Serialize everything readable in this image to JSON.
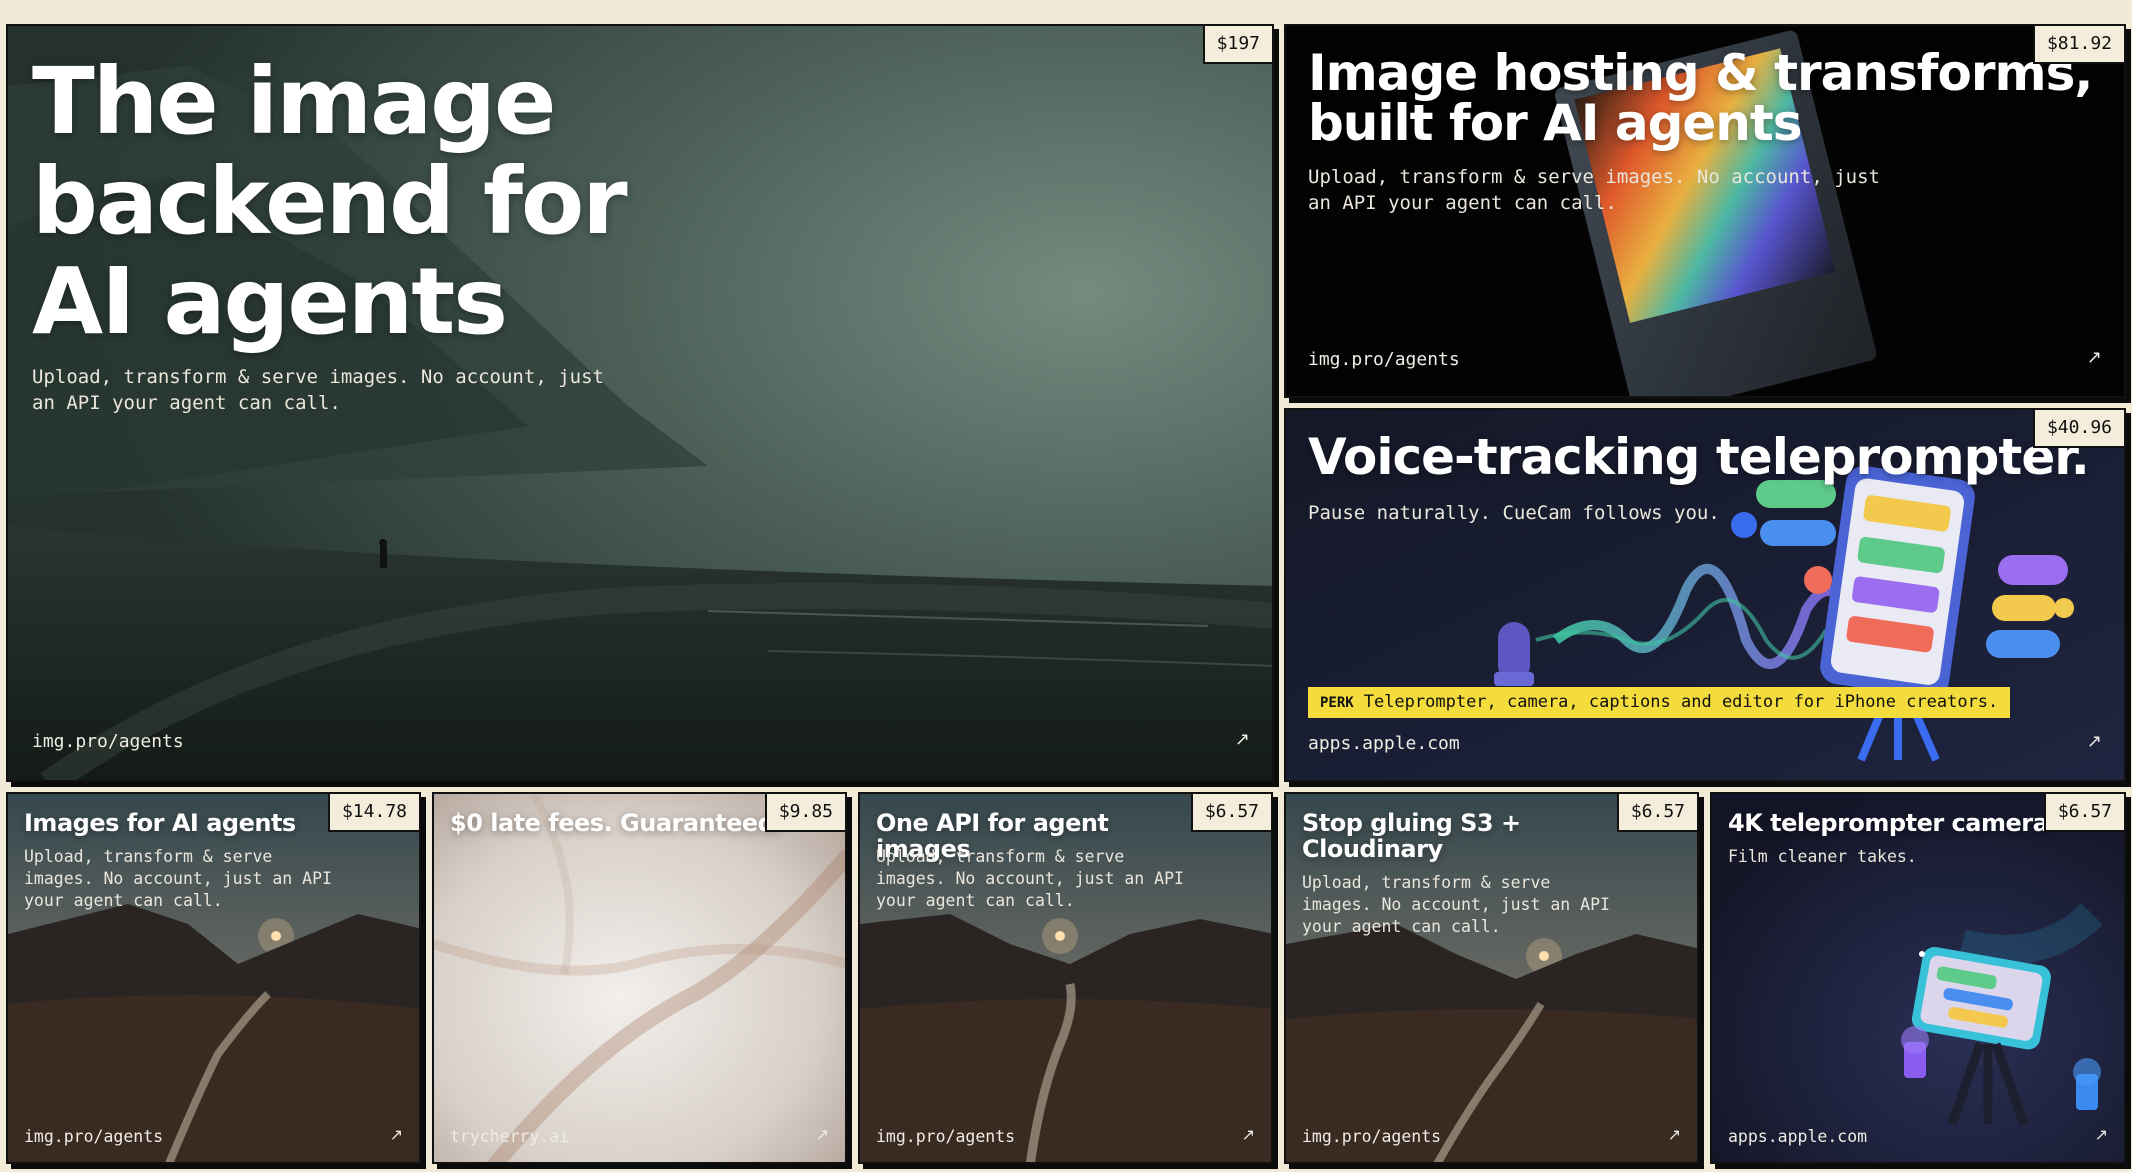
{
  "cards": [
    {
      "price": "$197",
      "title": "The image backend for AI agents",
      "description": "Upload, transform & serve images. No account, just\nan API your agent can call.",
      "domain": "img.pro/agents",
      "arrow": "↗"
    },
    {
      "price": "$81.92",
      "title": "Image hosting & transforms, built for AI agents",
      "description": "Upload, transform & serve images. No account, just\nan API your agent can call.",
      "domain": "img.pro/agents",
      "arrow": "↗"
    },
    {
      "price": "$40.96",
      "title": "Voice-tracking teleprompter.",
      "description": "Pause naturally. CueCam follows you.",
      "perk_tag": "PERK",
      "perk_text": "Teleprompter, camera, captions and editor for iPhone creators.",
      "domain": "apps.apple.com",
      "arrow": "↗"
    },
    {
      "price": "$14.78",
      "title": "Images for AI agents",
      "description": "Upload, transform & serve\nimages. No account, just an API\nyour agent can call.",
      "domain": "img.pro/agents",
      "arrow": "↗"
    },
    {
      "price": "$9.85",
      "title": "$0 late fees. Guaranteed.",
      "domain": "trycherry.ai",
      "arrow": "↗"
    },
    {
      "price": "$6.57",
      "title": "One API for agent images",
      "description": "Upload, transform & serve\nimages. No account, just an API\nyour agent can call.",
      "domain": "img.pro/agents",
      "arrow": "↗"
    },
    {
      "price": "$6.57",
      "title": "Stop gluing S3 + Cloudinary",
      "description": "Upload, transform & serve\nimages. No account, just an API\nyour agent can call.",
      "domain": "img.pro/agents",
      "arrow": "↗"
    },
    {
      "price": "$6.57",
      "title": "4K teleprompter camera.",
      "description": "Film cleaner takes.",
      "domain": "apps.apple.com",
      "arrow": "↗"
    }
  ]
}
